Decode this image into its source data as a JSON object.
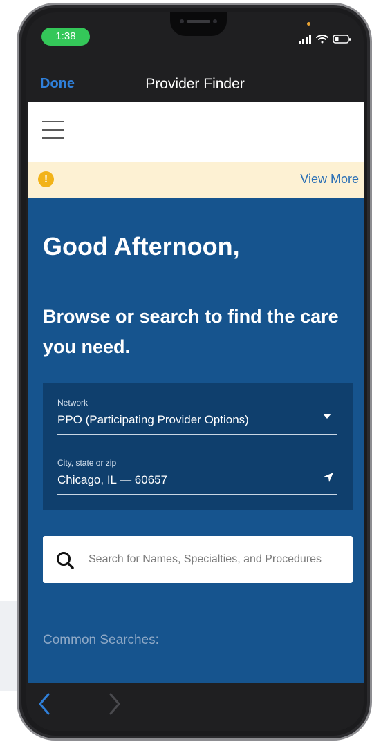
{
  "status_bar": {
    "time": "1:38"
  },
  "nav": {
    "done_label": "Done",
    "title": "Provider Finder"
  },
  "alert": {
    "view_more_label": "View More",
    "icon_glyph": "!"
  },
  "hero": {
    "greeting": "Good Afternoon,",
    "subtitle": "Browse or search to find the care you need."
  },
  "filters": {
    "network": {
      "label": "Network",
      "value": "PPO (Participating Provider Options)"
    },
    "location": {
      "label": "City, state or zip",
      "value": "Chicago, IL — 60657"
    }
  },
  "search": {
    "placeholder": "Search for Names, Specialties, and Procedures"
  },
  "common_searches": {
    "heading": "Common Searches:"
  },
  "colors": {
    "accent_blue": "#16548e",
    "panel_dark": "#0f3f6d",
    "link_blue": "#2f7fd9",
    "alert_bg": "#fdf1d3",
    "alert_icon": "#f2b319",
    "time_pill": "#34c759"
  },
  "icons": {
    "menu": "hamburger-icon",
    "alert": "warning-icon",
    "dropdown": "caret-down-icon",
    "location": "location-arrow-icon",
    "search": "search-icon",
    "back": "chevron-left-icon",
    "forward": "chevron-right-icon"
  }
}
